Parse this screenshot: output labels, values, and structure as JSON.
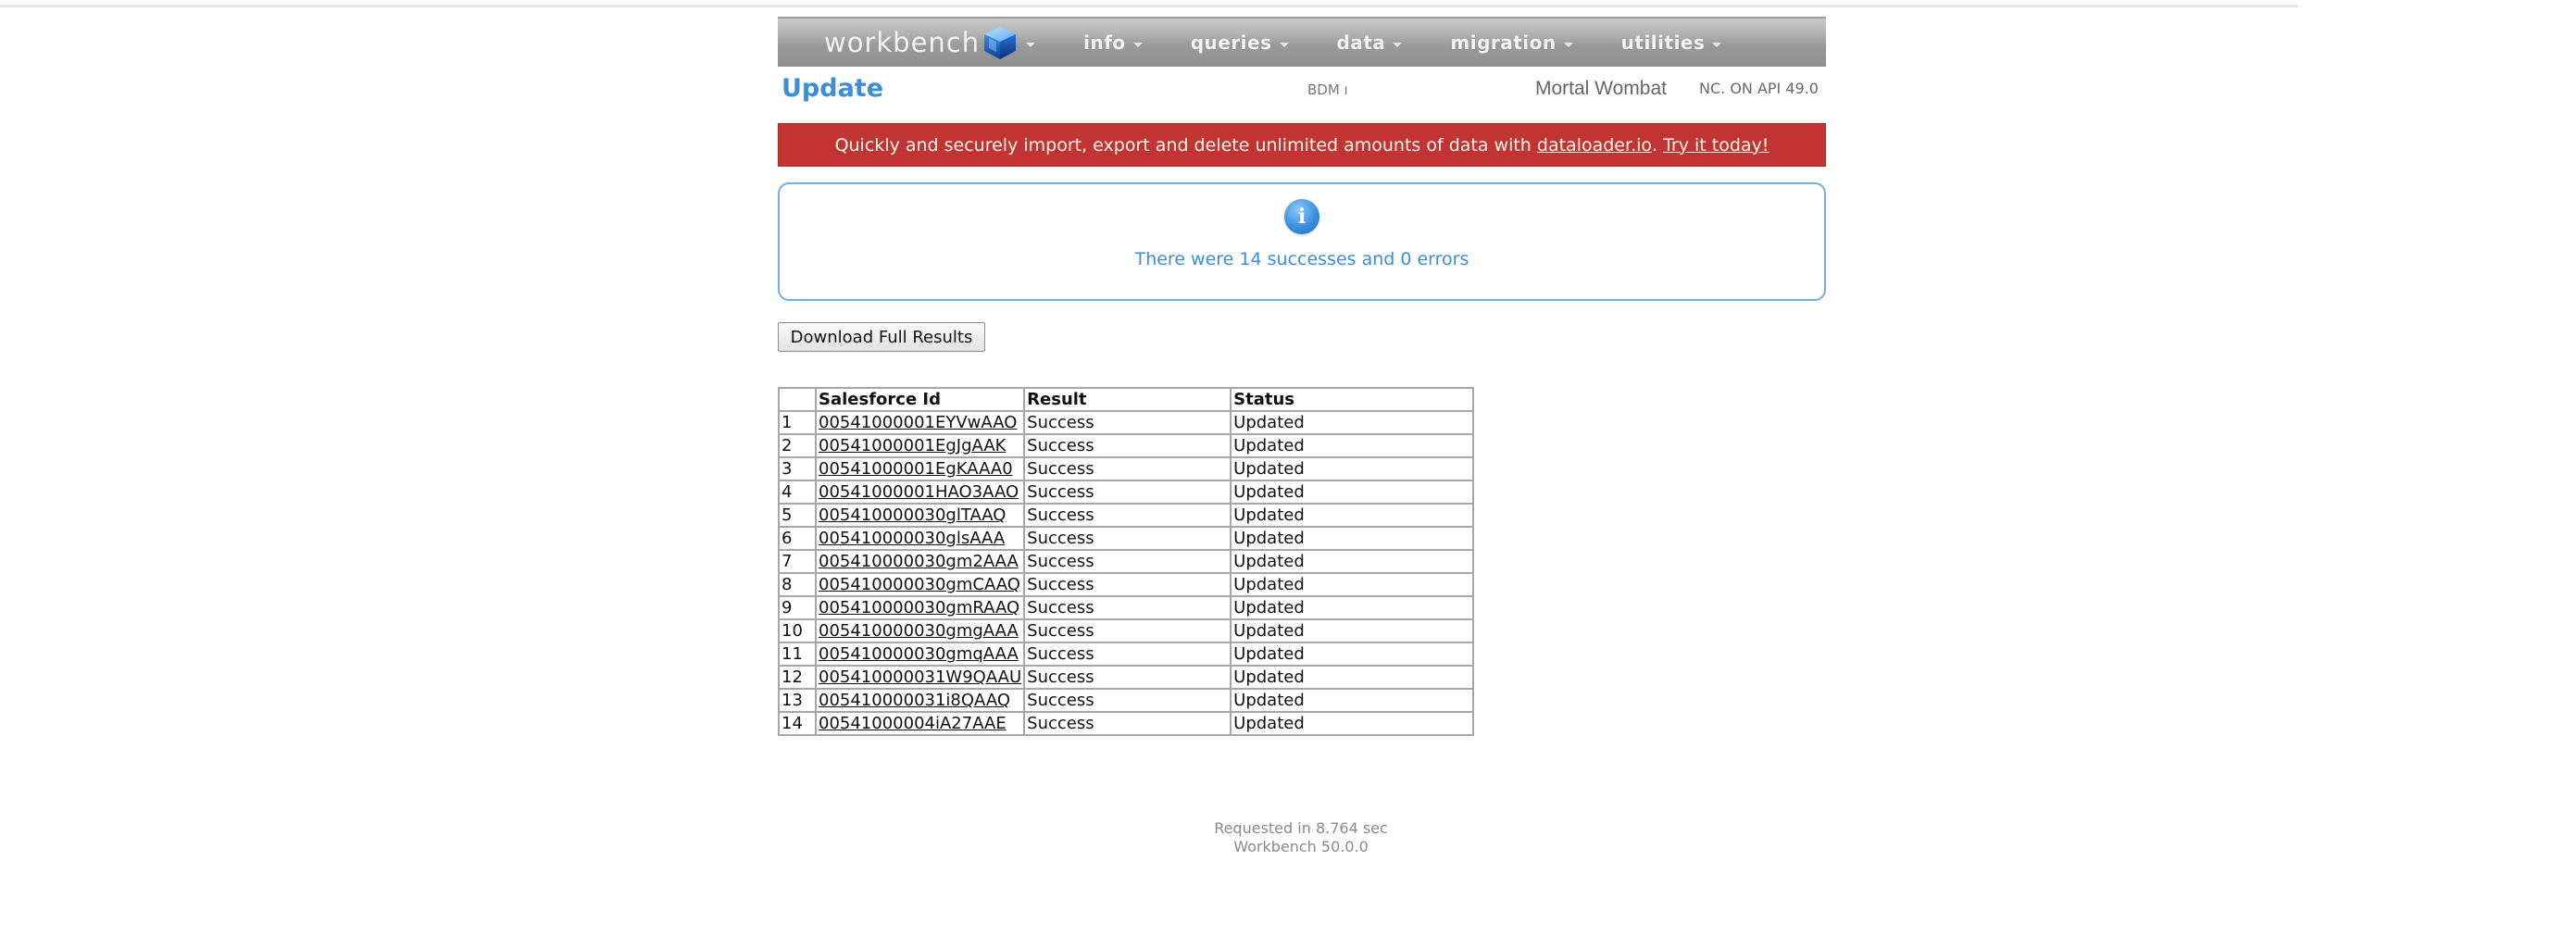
{
  "navbar": {
    "brand": "workbench",
    "brand_icon": "cube-logo-icon",
    "menu": [
      {
        "label": "info"
      },
      {
        "label": "queries"
      },
      {
        "label": "data"
      },
      {
        "label": "migration"
      },
      {
        "label": "utilities"
      }
    ]
  },
  "header": {
    "title": "Update",
    "org": "BDM ı",
    "user": "Mortal Wombat",
    "api": "NC. ON API 49.0"
  },
  "banner": {
    "text_before": "Quickly and securely import, export and delete unlimited amounts of data with ",
    "link1": "dataloader.io",
    "between": ". ",
    "link2": "Try it today!",
    "color": "#c23431"
  },
  "info": {
    "icon": "info-icon",
    "message": "There were 14 successes and 0 errors"
  },
  "actions": {
    "download_label": "Download Full Results"
  },
  "table": {
    "columns": [
      "",
      "Salesforce Id",
      "Result",
      "Status"
    ],
    "rows": [
      {
        "num": "1",
        "id": "00541000001EYVwAAO",
        "result": "Success",
        "status": "Updated"
      },
      {
        "num": "2",
        "id": "00541000001EgJgAAK",
        "result": "Success",
        "status": "Updated"
      },
      {
        "num": "3",
        "id": "00541000001EgKAAA0",
        "result": "Success",
        "status": "Updated"
      },
      {
        "num": "4",
        "id": "00541000001HAO3AAO",
        "result": "Success",
        "status": "Updated"
      },
      {
        "num": "5",
        "id": "005410000030glTAAQ",
        "result": "Success",
        "status": "Updated"
      },
      {
        "num": "6",
        "id": "005410000030glsAAA",
        "result": "Success",
        "status": "Updated"
      },
      {
        "num": "7",
        "id": "005410000030gm2AAA",
        "result": "Success",
        "status": "Updated"
      },
      {
        "num": "8",
        "id": "005410000030gmCAAQ",
        "result": "Success",
        "status": "Updated"
      },
      {
        "num": "9",
        "id": "005410000030gmRAAQ",
        "result": "Success",
        "status": "Updated"
      },
      {
        "num": "10",
        "id": "005410000030gmgAAA",
        "result": "Success",
        "status": "Updated"
      },
      {
        "num": "11",
        "id": "005410000030gmqAAA",
        "result": "Success",
        "status": "Updated"
      },
      {
        "num": "12",
        "id": "005410000031W9QAAU",
        "result": "Success",
        "status": "Updated"
      },
      {
        "num": "13",
        "id": "005410000031i8QAAQ",
        "result": "Success",
        "status": "Updated"
      },
      {
        "num": "14",
        "id": "00541000004iA27AAE",
        "result": "Success",
        "status": "Updated"
      }
    ]
  },
  "footer": {
    "timing": "Requested in 8.764 sec",
    "version": "Workbench 50.0.0"
  }
}
